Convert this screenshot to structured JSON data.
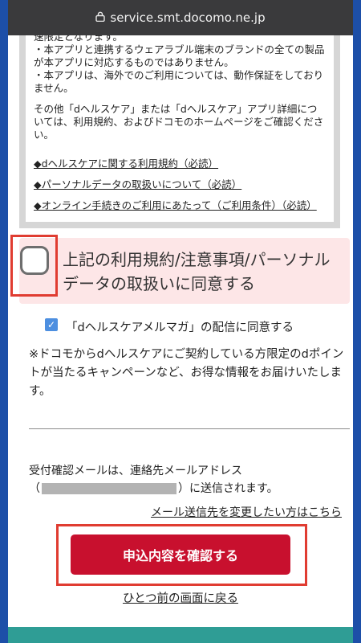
{
  "browser": {
    "url": "service.smt.docomo.ne.jp"
  },
  "terms": {
    "lines": [
      "速限定となります。",
      "・本アプリと連携するウェアラブル端末のブランドの全ての製品が本アプリに対応するものではありません。",
      "・本アプリは、海外でのご利用については、動作保証をしておりません。"
    ],
    "other_info": "その他「dヘルスケア」または「dヘルスケア」アプリ詳細については、利用規約、およびドコモのホームページをご確認ください。",
    "links": [
      "◆dヘルスケアに関する利用規約（必読）",
      "◆パーソナルデータの取扱いについて（必読）",
      "◆オンライン手続きのご利用にあたって（ご利用条件）（必読）"
    ]
  },
  "agree": {
    "label": "上記の利用規約/注意事項/パーソナルデータの取扱いに同意する",
    "checked": false
  },
  "mailmag": {
    "label": "「dヘルスケアメルマガ」の配信に同意する",
    "checked": true,
    "note": "※ドコモからdヘルスケアにご契約している方限定のdポイントが当たるキャンペーンなど、お得な情報をお届けいたします。"
  },
  "confirmation": {
    "line1": "受付確認メールは、連絡先メールアドレス",
    "open_paren": "（",
    "line2_suffix": "）に送信されます。",
    "change_link": "メール送信先を変更したい方はこちら"
  },
  "actions": {
    "submit": "申込内容を確認する",
    "back": "ひとつ前の画面に戻る"
  },
  "colors": {
    "primary": "#c8102e",
    "highlight": "#e03c31",
    "agree_bg": "#fde6e7",
    "checkbox": "#4d8fe0"
  }
}
